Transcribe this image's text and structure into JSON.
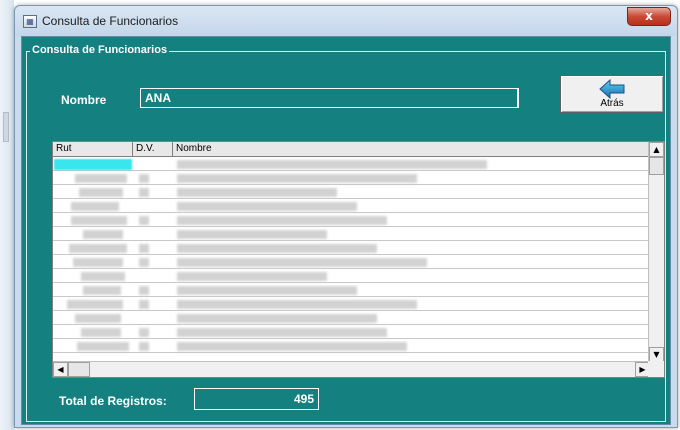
{
  "window": {
    "title": "Consulta de Funcionarios",
    "icon": "form-icon",
    "close_label": "x"
  },
  "group": {
    "legend": "Consulta de Funcionarios"
  },
  "filter": {
    "label": "Nombre",
    "value": "ANA"
  },
  "back_button": {
    "label": "Atrás",
    "icon": "arrow-left-icon"
  },
  "grid": {
    "columns": [
      "Rut",
      "D.V.",
      "Nombre"
    ],
    "visible_rows": 14,
    "selected_row": 0
  },
  "scroll": {
    "up": "▲",
    "down": "▼",
    "left": "◀",
    "right": "▶"
  },
  "total": {
    "label": "Total de Registros:",
    "value": "495"
  },
  "colors": {
    "form_background": "#158080",
    "selection": "#38e6ee",
    "window_frame": "#c9dced"
  }
}
